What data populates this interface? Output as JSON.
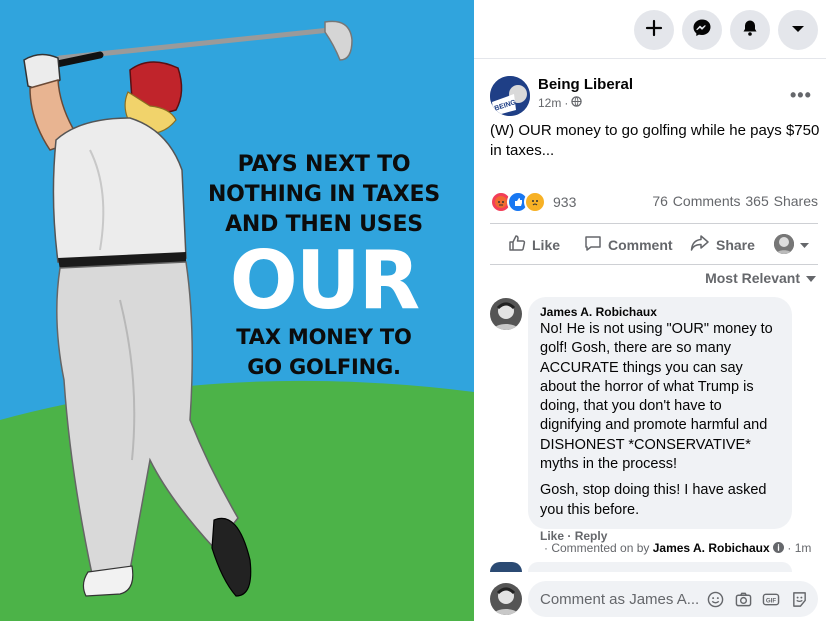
{
  "image": {
    "headline_line1": "PAYS NEXT TO",
    "headline_line2": "NOTHING IN TAXES",
    "headline_line3": "AND THEN USES",
    "headline_big": "OUR",
    "headline_line4": "TAX MONEY TO",
    "headline_line5": "GO GOLFING.",
    "colors": {
      "sky": "#30a4dd",
      "grass": "#4cb348"
    }
  },
  "topbar": {
    "icons": [
      "plus-icon",
      "messenger-icon",
      "bell-icon",
      "caret-down-icon"
    ]
  },
  "post": {
    "author": "Being Liberal",
    "time": "12m",
    "privacy_icon": "globe-icon",
    "more_icon": "more-dots-icon",
    "text": "(W) OUR money to go golfing while he pays $750 in taxes...",
    "reaction_count": "933",
    "comments_count": "76 Comments",
    "shares_count": "365 Shares"
  },
  "actions": {
    "like": "Like",
    "comment": "Comment",
    "share": "Share"
  },
  "sort": {
    "label": "Most Relevant"
  },
  "comment": {
    "author": "James A. Robichaux",
    "para1": "No! He is not using \"OUR\" money to golf! Gosh, there are so many ACCURATE things you can say about the horror of what Trump is doing, that you don't have to dignifying and promote harmful and DISHONEST *CONSERVATIVE* myths in the process!",
    "para2": "Gosh, stop doing this! I have asked you this before.",
    "like": "Like",
    "reply": "Reply",
    "commented_on_prefix": "· Commented on by",
    "commented_by": "James A. Robichaux",
    "time": "· 1m"
  },
  "composer": {
    "placeholder": "Comment as James A...",
    "icons": [
      "smiley-icon",
      "camera-icon",
      "gif-icon",
      "sticker-icon"
    ]
  }
}
